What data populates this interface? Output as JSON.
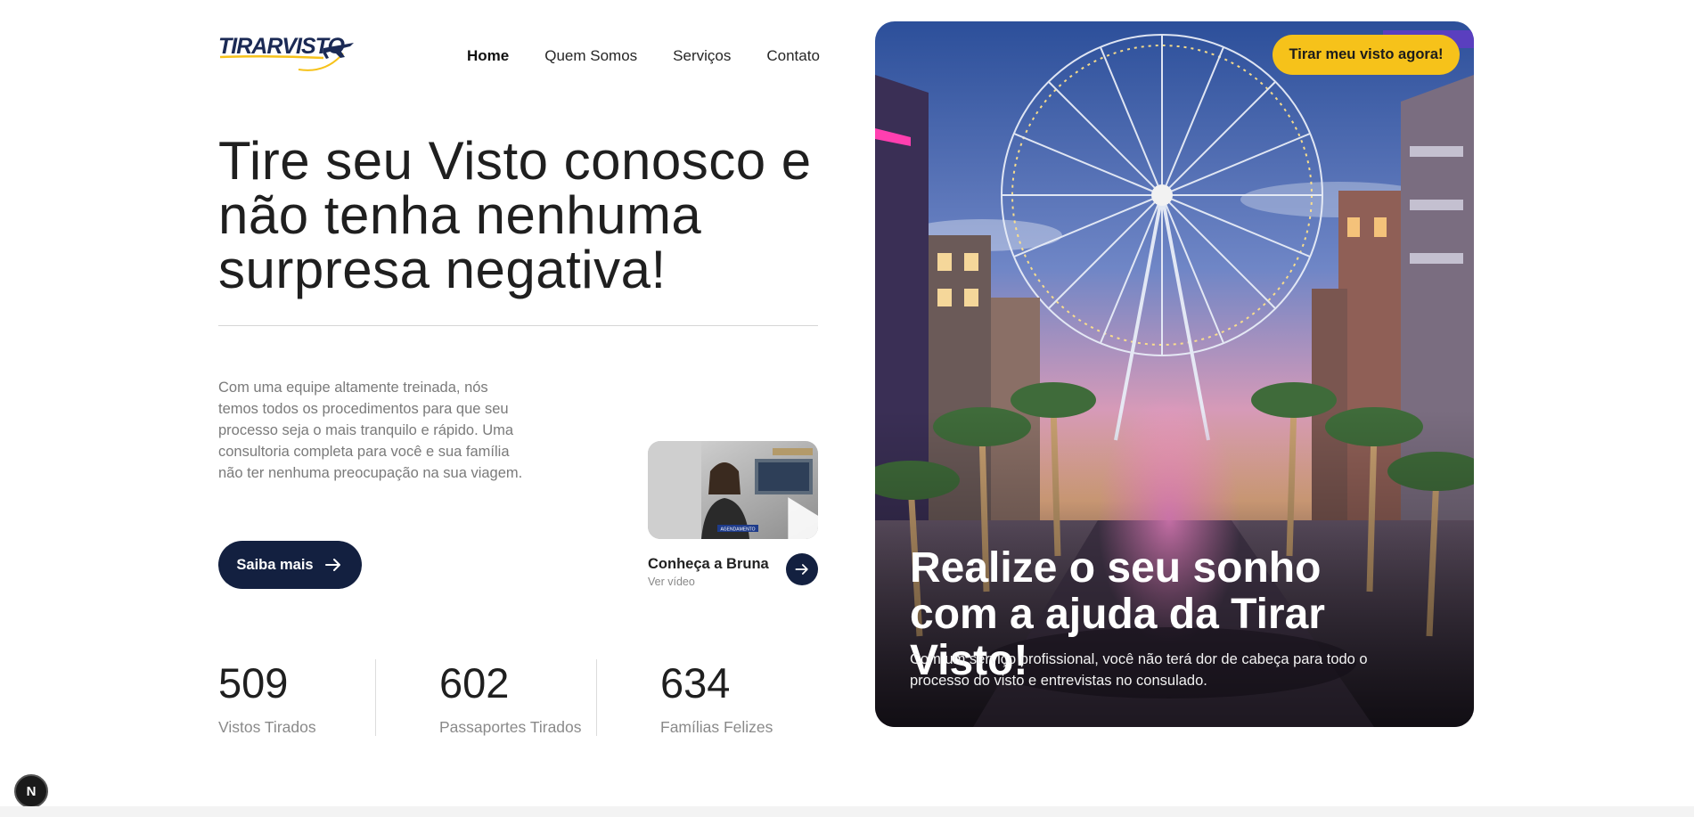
{
  "brand": {
    "logo_text": "TIRARVISTO",
    "accent": "#f6c21a",
    "dark": "#132040"
  },
  "nav": {
    "items": [
      {
        "label": "Home",
        "active": true
      },
      {
        "label": "Quem Somos",
        "active": false
      },
      {
        "label": "Serviços",
        "active": false
      },
      {
        "label": "Contato",
        "active": false
      }
    ]
  },
  "hero": {
    "title": "Tire seu Visto conosco e não tenha nenhuma surpresa negativa!",
    "description": "Com uma equipe altamente treinada, nós temos todos os procedimentos para que seu processo seja o mais tranquilo e rápido. Uma consultoria completa para você e sua família não ter nenhuma preocupação na sua viagem.",
    "button_label": "Saiba mais",
    "button_icon": "arrow-right-icon"
  },
  "video": {
    "thumb_caption": "AGENDAMENTO",
    "title": "Conheça a Bruna",
    "subtitle": "Ver vídeo",
    "icons": [
      "play-icon",
      "arrow-right-icon"
    ]
  },
  "stats": [
    {
      "value": "509",
      "label": "Vistos Tirados"
    },
    {
      "value": "602",
      "label": "Passaportes Tirados"
    },
    {
      "value": "634",
      "label": "Famílias Felizes"
    }
  ],
  "card": {
    "cta_label": "Tirar meu visto agora!",
    "title": "Realize o seu sonho com a ajuda da Tirar Visto!",
    "text": "Com um serviço profissional, você não terá dor de cabeça para todo o processo do visto e entrevistas no consulado."
  },
  "badge": {
    "label": "N"
  }
}
